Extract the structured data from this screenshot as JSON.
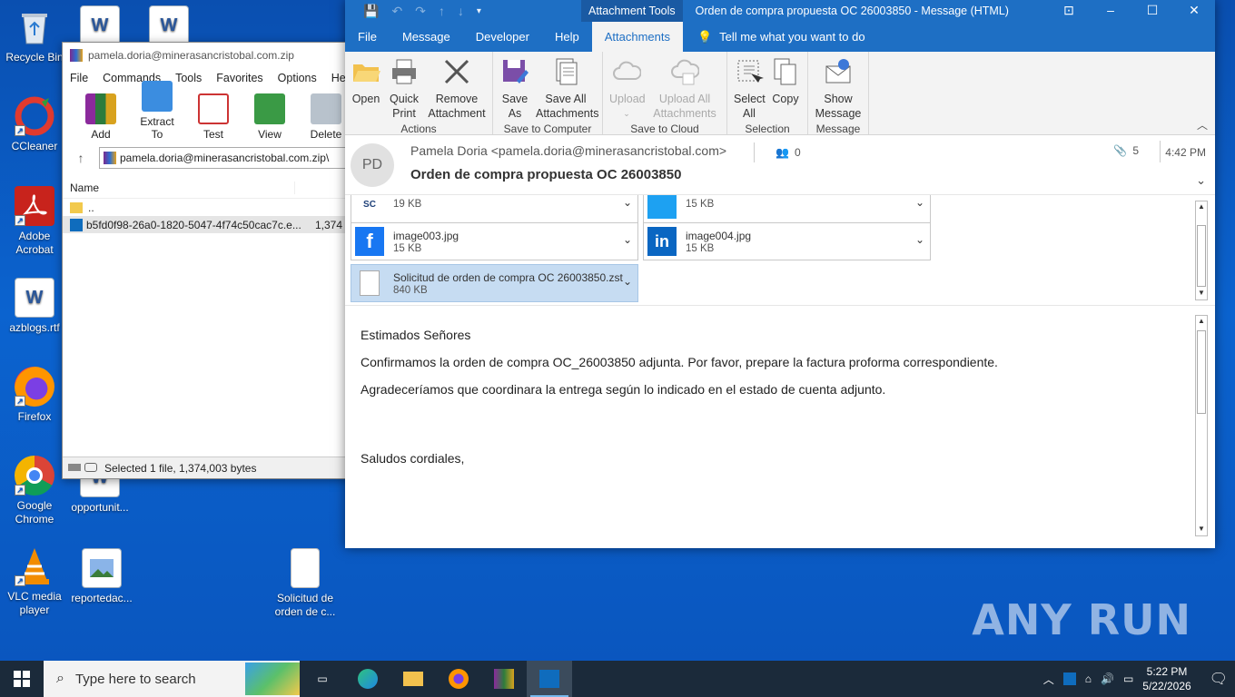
{
  "desktop": {
    "icons": [
      {
        "label": "Recycle Bin"
      },
      {
        "label": "CCleaner"
      },
      {
        "label": "Adobe Acrobat"
      },
      {
        "label": "azblogs.rtf"
      },
      {
        "label": "Firefox"
      },
      {
        "label": "Google Chrome"
      },
      {
        "label": "VLC media player"
      },
      {
        "label": "opportunit..."
      },
      {
        "label": "reportedac..."
      },
      {
        "label": "Solicitud de orden de c..."
      }
    ]
  },
  "winrar": {
    "title": "pamela.doria@minerasancristobal.com.zip",
    "menu": [
      "File",
      "Commands",
      "Tools",
      "Favorites",
      "Options",
      "Help"
    ],
    "toolbar": [
      "Add",
      "Extract To",
      "Test",
      "View",
      "Delete"
    ],
    "address": "pamela.doria@minerasancristobal.com.zip\\",
    "columns": {
      "name": "Name"
    },
    "rows": [
      {
        "name": "..",
        "size": ""
      },
      {
        "name": "b5fd0f98-26a0-1820-5047-4f74c50cac7c.e...",
        "size": "1,374"
      }
    ],
    "status": "Selected 1 file, 1,374,003 bytes"
  },
  "outlook": {
    "context_tab": "Attachment Tools",
    "window_title": "Orden de compra propuesta OC 26003850  -  Message (HTML)",
    "tabs": [
      "File",
      "Message",
      "Developer",
      "Help",
      "Attachments"
    ],
    "tell_me": "Tell me what you want to do",
    "ribbon": {
      "groups": [
        {
          "label": "Actions",
          "buttons": [
            "Open",
            "Quick Print",
            "Remove Attachment"
          ]
        },
        {
          "label": "Save to Computer",
          "buttons": [
            "Save As",
            "Save All Attachments"
          ]
        },
        {
          "label": "Save to Cloud",
          "buttons": [
            "Upload",
            "Upload All Attachments"
          ]
        },
        {
          "label": "Selection",
          "buttons": [
            "Select All",
            "Copy"
          ]
        },
        {
          "label": "Message",
          "buttons": [
            "Show Message"
          ]
        }
      ]
    },
    "header": {
      "initials": "PD",
      "from": "Pamela Doria <pamela.doria@minerasancristobal.com>",
      "subject": "Orden de compra propuesta OC 26003850",
      "people_count": "0",
      "attachment_count": "5",
      "time": "4:42 PM"
    },
    "attachments": [
      {
        "name": "",
        "size": "19 KB"
      },
      {
        "name": "",
        "size": "15 KB"
      },
      {
        "name": "image003.jpg",
        "size": "15 KB"
      },
      {
        "name": "image004.jpg",
        "size": "15 KB"
      },
      {
        "name": "Solicitud de orden de compra OC 26003850.zst",
        "size": "840 KB"
      }
    ],
    "body": [
      "Estimados Señores",
      "Confirmamos la orden de compra OC_26003850 adjunta. Por favor, prepare la factura proforma correspondiente.",
      "Agradeceríamos que coordinara la entrega según lo indicado en el estado de cuenta adjunto.",
      "Saludos cordiales,"
    ]
  },
  "taskbar": {
    "search_placeholder": "Type here to search",
    "time": "5:22 PM",
    "date": "5/22/2026"
  },
  "watermark": "ANY RUN",
  "colors": {
    "outlook_blue": "#1e6fc4",
    "selected_attachment": "#c6dcf2",
    "desktop_blue": "#0b63cf"
  }
}
